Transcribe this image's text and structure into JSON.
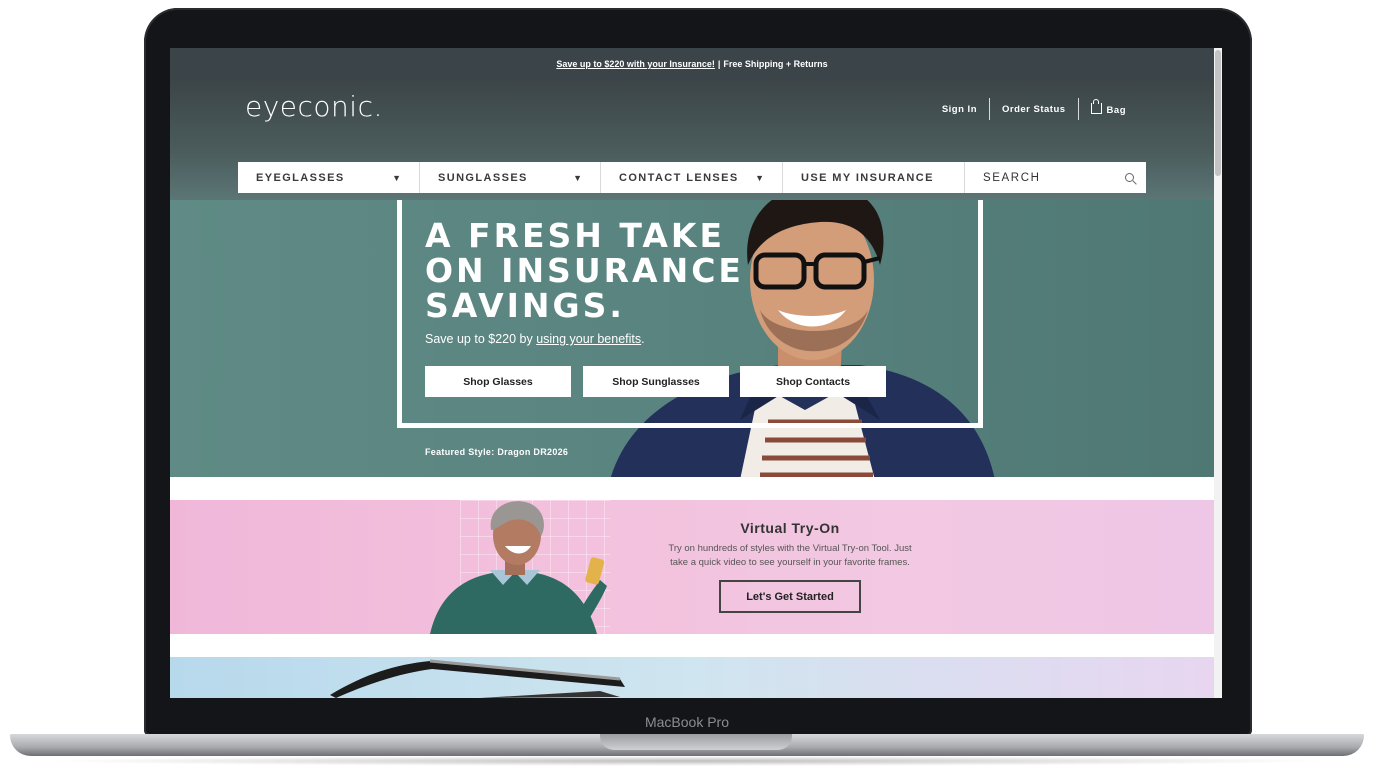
{
  "device": {
    "label": "MacBook Pro"
  },
  "announcement": {
    "link_text": "Save up to $220 with your Insurance!",
    "separator": "|",
    "text": "Free Shipping + Returns"
  },
  "header": {
    "logo": "eyeconic.",
    "util": {
      "sign_in": "Sign In",
      "order_status": "Order Status",
      "bag": "Bag"
    }
  },
  "nav": {
    "items": [
      {
        "label": "EYEGLASSES",
        "caret": "▼"
      },
      {
        "label": "SUNGLASSES",
        "caret": "▼"
      },
      {
        "label": "CONTACT LENSES",
        "caret": "▼"
      },
      {
        "label": "USE MY INSURANCE"
      }
    ],
    "search_label": "SEARCH"
  },
  "hero": {
    "title_lines": [
      "A FRESH TAKE",
      "ON INSURANCE",
      "SAVINGS."
    ],
    "sub_prefix": "Save up to $220 by ",
    "sub_link": "using your benefits",
    "sub_suffix": ".",
    "buttons": [
      "Shop Glasses",
      "Shop Sunglasses",
      "Shop Contacts"
    ],
    "featured": "Featured Style: Dragon DR2026"
  },
  "vto": {
    "title": "Virtual Try-On",
    "text_line1": "Try on hundreds of styles with the Virtual Try-on Tool. Just",
    "text_line2": "take a quick video to see yourself in your favorite frames.",
    "button": "Let's Get Started"
  },
  "colors": {
    "announce_bg": "#3a4449",
    "hero_bg": "#5f8a85",
    "vto_bg": "#f3c1dd"
  }
}
